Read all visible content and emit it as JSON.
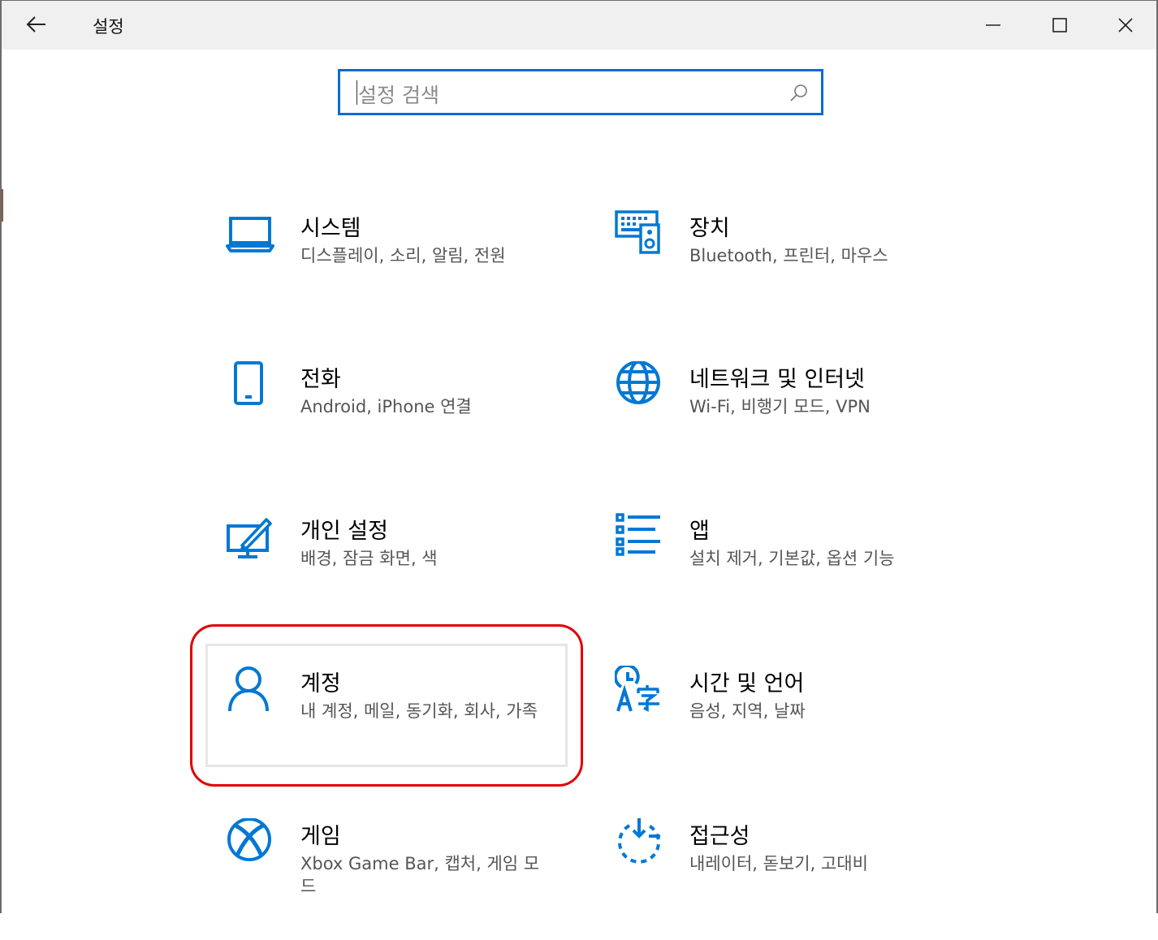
{
  "window": {
    "title": "설정"
  },
  "search": {
    "placeholder": "설정 검색"
  },
  "colors": {
    "accent": "#0078d4",
    "highlight_ring": "#e00000"
  },
  "categories": [
    {
      "title": "시스템",
      "desc": "디스플레이, 소리, 알림, 전원",
      "icon": "laptop-icon"
    },
    {
      "title": "장치",
      "desc": "Bluetooth, 프린터, 마우스",
      "icon": "devices-icon"
    },
    {
      "title": "전화",
      "desc": "Android, iPhone 연결",
      "icon": "phone-icon"
    },
    {
      "title": "네트워크 및 인터넷",
      "desc": "Wi-Fi, 비행기 모드, VPN",
      "icon": "globe-icon"
    },
    {
      "title": "개인 설정",
      "desc": "배경, 잠금 화면, 색",
      "icon": "personalization-icon"
    },
    {
      "title": "앱",
      "desc": "설치 제거, 기본값, 옵션 기능",
      "icon": "apps-list-icon"
    },
    {
      "title": "계정",
      "desc": "내 계정, 메일, 동기화, 회사, 가족",
      "icon": "person-icon"
    },
    {
      "title": "시간 및 언어",
      "desc": "음성, 지역, 날짜",
      "icon": "time-language-icon"
    },
    {
      "title": "게임",
      "desc": "Xbox Game Bar, 캡처, 게임 모드",
      "icon": "xbox-icon"
    },
    {
      "title": "접근성",
      "desc": "내레이터, 돋보기, 고대비",
      "icon": "accessibility-icon"
    }
  ]
}
